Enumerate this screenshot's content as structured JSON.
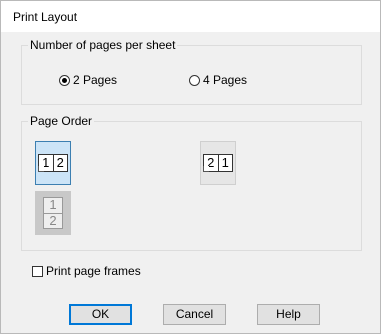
{
  "dialog": {
    "title": "Print Layout"
  },
  "pages_per_sheet": {
    "legend": "Number of pages per sheet",
    "options": [
      {
        "label": "2 Pages",
        "checked": true
      },
      {
        "label": "4 Pages",
        "checked": false
      }
    ]
  },
  "page_order": {
    "legend": "Page Order",
    "items": [
      {
        "cells": [
          "1",
          "2"
        ],
        "state": "selected",
        "icon": "left-to-right-icon"
      },
      {
        "cells": [
          "2",
          "1"
        ],
        "state": "normal",
        "icon": "right-to-left-icon"
      },
      {
        "cells": [
          "1",
          "2"
        ],
        "state": "disabled",
        "icon": "top-to-bottom-icon"
      }
    ]
  },
  "print_frames": {
    "label": "Print page frames",
    "checked": false
  },
  "buttons": {
    "ok": "OK",
    "cancel": "Cancel",
    "help": "Help"
  },
  "colors": {
    "selection": "#cce4f7",
    "selection_border": "#3c7fb1",
    "default_button": "#0078d7"
  }
}
